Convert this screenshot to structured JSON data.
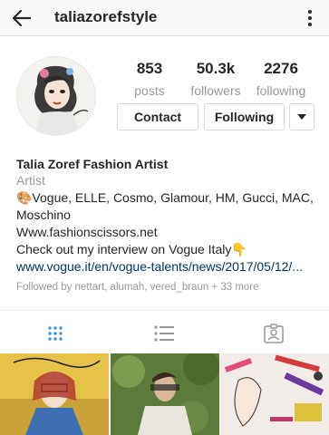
{
  "header": {
    "username": "taliazorefstyle",
    "back_icon": "arrow-left-icon",
    "more_icon": "more-vertical-icon"
  },
  "profile": {
    "avatar_icon": "profile-avatar",
    "stats": [
      {
        "value": "853",
        "label": "posts"
      },
      {
        "value": "50.3k",
        "label": "followers"
      },
      {
        "value": "2276",
        "label": "following"
      }
    ],
    "contact_label": "Contact",
    "following_label": "Following",
    "dropdown_icon": "caret-down-icon"
  },
  "bio": {
    "name": "Talia Zoref Fashion Artist",
    "category": "Artist",
    "brands_line1": "🎨Vogue, ELLE, Cosmo, Glamour, HM, Gucci, MAC,",
    "brands_line2": "Moschino",
    "website": "Www.fashionscissors.net",
    "interview": "Check out my interview on Vogue Italy👇",
    "link": "www.vogue.it/en/vogue-talents/news/2017/05/12/...",
    "followed_by": "Followed by nettart, alumah, vered_braun + 33 more"
  },
  "tabs": [
    {
      "icon": "grid-icon",
      "active": true
    },
    {
      "icon": "list-icon",
      "active": false
    },
    {
      "icon": "tagged-icon",
      "active": false
    }
  ],
  "colors": {
    "accent": "#3897f0",
    "link": "#003569",
    "muted": "#999999",
    "border": "#dbdbdb"
  }
}
